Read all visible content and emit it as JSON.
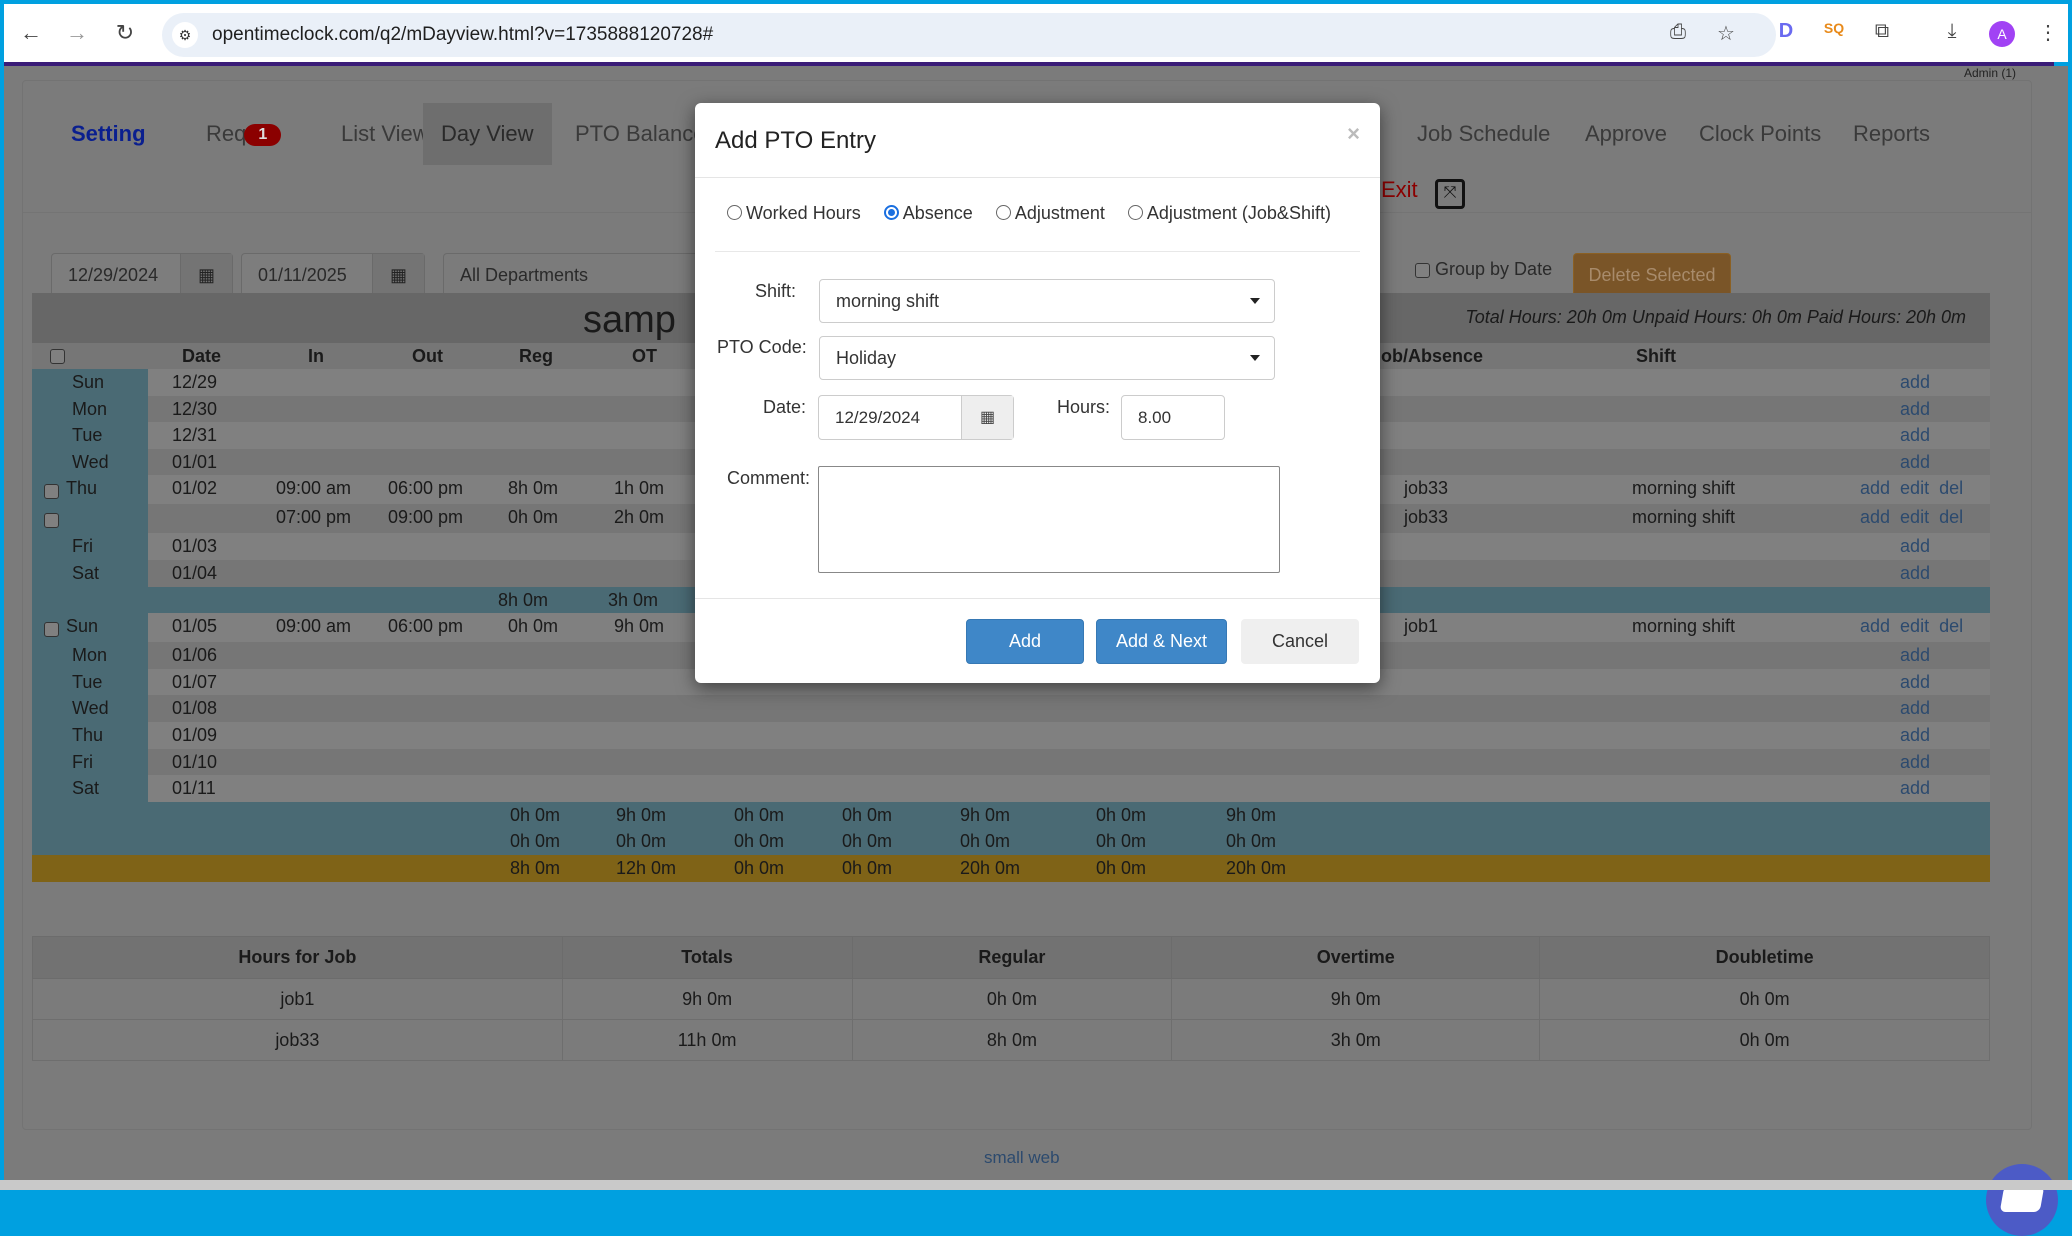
{
  "browser": {
    "url": "opentimeclock.com/q2/mDayview.html?v=1735888120728#",
    "profile_initial": "A",
    "icons": [
      "back-icon",
      "forward-icon",
      "reload-icon",
      "site-info-icon",
      "install-icon",
      "bookmark-star-icon",
      "extension-d-icon",
      "extension-sq-icon",
      "extensions-puzzle-icon",
      "download-icon",
      "menu-kebab-icon"
    ]
  },
  "header": {
    "user": "Admin (1)"
  },
  "nav": {
    "tabs": [
      {
        "label": "Setting"
      },
      {
        "label": "Req",
        "badge": "1"
      },
      {
        "label": "List View"
      },
      {
        "label": "Day View",
        "active": true
      },
      {
        "label": "PTO Balance"
      },
      {
        "label": "Job Schedule"
      },
      {
        "label": "Approve"
      },
      {
        "label": "Clock Points"
      },
      {
        "label": "Reports"
      }
    ],
    "exit_label": "Exit"
  },
  "filters": {
    "start_date": "12/29/2024",
    "end_date": "01/11/2025",
    "department": "All Departments",
    "group_by_date_label": "Group by Date",
    "delete_selected_label": "Delete Selected"
  },
  "timesheet": {
    "employee_title": "samp",
    "summary": "Total Hours: 20h 0m Unpaid Hours: 0h 0m Paid Hours: 20h 0m",
    "columns": [
      "Date",
      "In",
      "Out",
      "Reg",
      "OT",
      "Job/Absence",
      "Shift"
    ],
    "rows": [
      {
        "day": "Sun",
        "date": "12/29",
        "in": "",
        "out": "",
        "reg": "",
        "ot": "",
        "job": "",
        "shift": "",
        "links": [
          "add"
        ]
      },
      {
        "day": "Mon",
        "date": "12/30",
        "in": "",
        "out": "",
        "reg": "",
        "ot": "",
        "job": "",
        "shift": "",
        "links": [
          "add"
        ]
      },
      {
        "day": "Tue",
        "date": "12/31",
        "in": "",
        "out": "",
        "reg": "",
        "ot": "",
        "job": "",
        "shift": "",
        "links": [
          "add"
        ]
      },
      {
        "day": "Wed",
        "date": "01/01",
        "in": "",
        "out": "",
        "reg": "",
        "ot": "",
        "job": "",
        "shift": "",
        "links": [
          "add"
        ]
      },
      {
        "day": "Thu",
        "date": "01/02",
        "in": "09:00 am",
        "out": "06:00 pm",
        "reg": "8h 0m",
        "ot": "1h 0m",
        "job": "job33",
        "shift": "morning shift",
        "links": [
          "add",
          "edit",
          "del"
        ],
        "checkbox": true
      },
      {
        "day": "",
        "date": "",
        "in": "07:00 pm",
        "out": "09:00 pm",
        "reg": "0h 0m",
        "ot": "2h 0m",
        "job": "job33",
        "shift": "morning shift",
        "links": [
          "add",
          "edit",
          "del"
        ],
        "checkbox": true
      },
      {
        "day": "Fri",
        "date": "01/03",
        "in": "",
        "out": "",
        "reg": "",
        "ot": "",
        "job": "",
        "shift": "",
        "links": [
          "add"
        ]
      },
      {
        "day": "Sat",
        "date": "01/04",
        "in": "",
        "out": "",
        "reg": "",
        "ot": "",
        "job": "",
        "shift": "",
        "links": [
          "add"
        ]
      },
      {
        "subtotal": true,
        "reg": "8h 0m",
        "ot": "3h 0m"
      },
      {
        "day": "Sun",
        "date": "01/05",
        "in": "09:00 am",
        "out": "06:00 pm",
        "reg": "0h 0m",
        "ot": "9h 0m",
        "job": "job1",
        "shift": "morning shift",
        "links": [
          "add",
          "edit",
          "del"
        ],
        "checkbox": true
      },
      {
        "day": "Mon",
        "date": "01/06",
        "links": [
          "add"
        ]
      },
      {
        "day": "Tue",
        "date": "01/07",
        "links": [
          "add"
        ]
      },
      {
        "day": "Wed",
        "date": "01/08",
        "links": [
          "add"
        ]
      },
      {
        "day": "Thu",
        "date": "01/09",
        "links": [
          "add"
        ]
      },
      {
        "day": "Fri",
        "date": "01/10",
        "links": [
          "add"
        ]
      },
      {
        "day": "Sat",
        "date": "01/11",
        "links": [
          "add"
        ]
      }
    ],
    "week2_totals": [
      "0h 0m",
      "9h 0m",
      "0h 0m",
      "0h 0m",
      "9h 0m",
      "0h 0m",
      "9h 0m"
    ],
    "week2_totals_b": [
      "0h 0m",
      "0h 0m",
      "0h 0m",
      "0h 0m",
      "0h 0m",
      "0h 0m",
      "0h 0m"
    ],
    "grand_totals": [
      "8h 0m",
      "12h 0m",
      "0h 0m",
      "0h 0m",
      "20h 0m",
      "0h 0m",
      "20h 0m"
    ]
  },
  "job_summary": {
    "columns": [
      "Hours for Job",
      "Totals",
      "Regular",
      "Overtime",
      "Doubletime"
    ],
    "rows": [
      [
        "job1",
        "9h 0m",
        "0h 0m",
        "9h 0m",
        "0h 0m"
      ],
      [
        "job33",
        "11h 0m",
        "8h 0m",
        "3h 0m",
        "0h 0m"
      ]
    ]
  },
  "footer": {
    "link": "small web"
  },
  "dialog": {
    "title": "Add PTO Entry",
    "close": "×",
    "types": [
      {
        "label": "Worked Hours",
        "checked": false
      },
      {
        "label": "Absence",
        "checked": true
      },
      {
        "label": "Adjustment",
        "checked": false
      },
      {
        "label": "Adjustment (Job&Shift)",
        "checked": false
      }
    ],
    "shift_label": "Shift:",
    "shift_value": "morning shift",
    "pto_code_label": "PTO Code:",
    "pto_code_value": "Holiday",
    "date_label": "Date:",
    "date_value": "12/29/2024",
    "hours_label": "Hours:",
    "hours_value": "8.00",
    "comment_label": "Comment:",
    "comment_value": "",
    "buttons": {
      "add": "Add",
      "add_next": "Add & Next",
      "cancel": "Cancel"
    }
  }
}
